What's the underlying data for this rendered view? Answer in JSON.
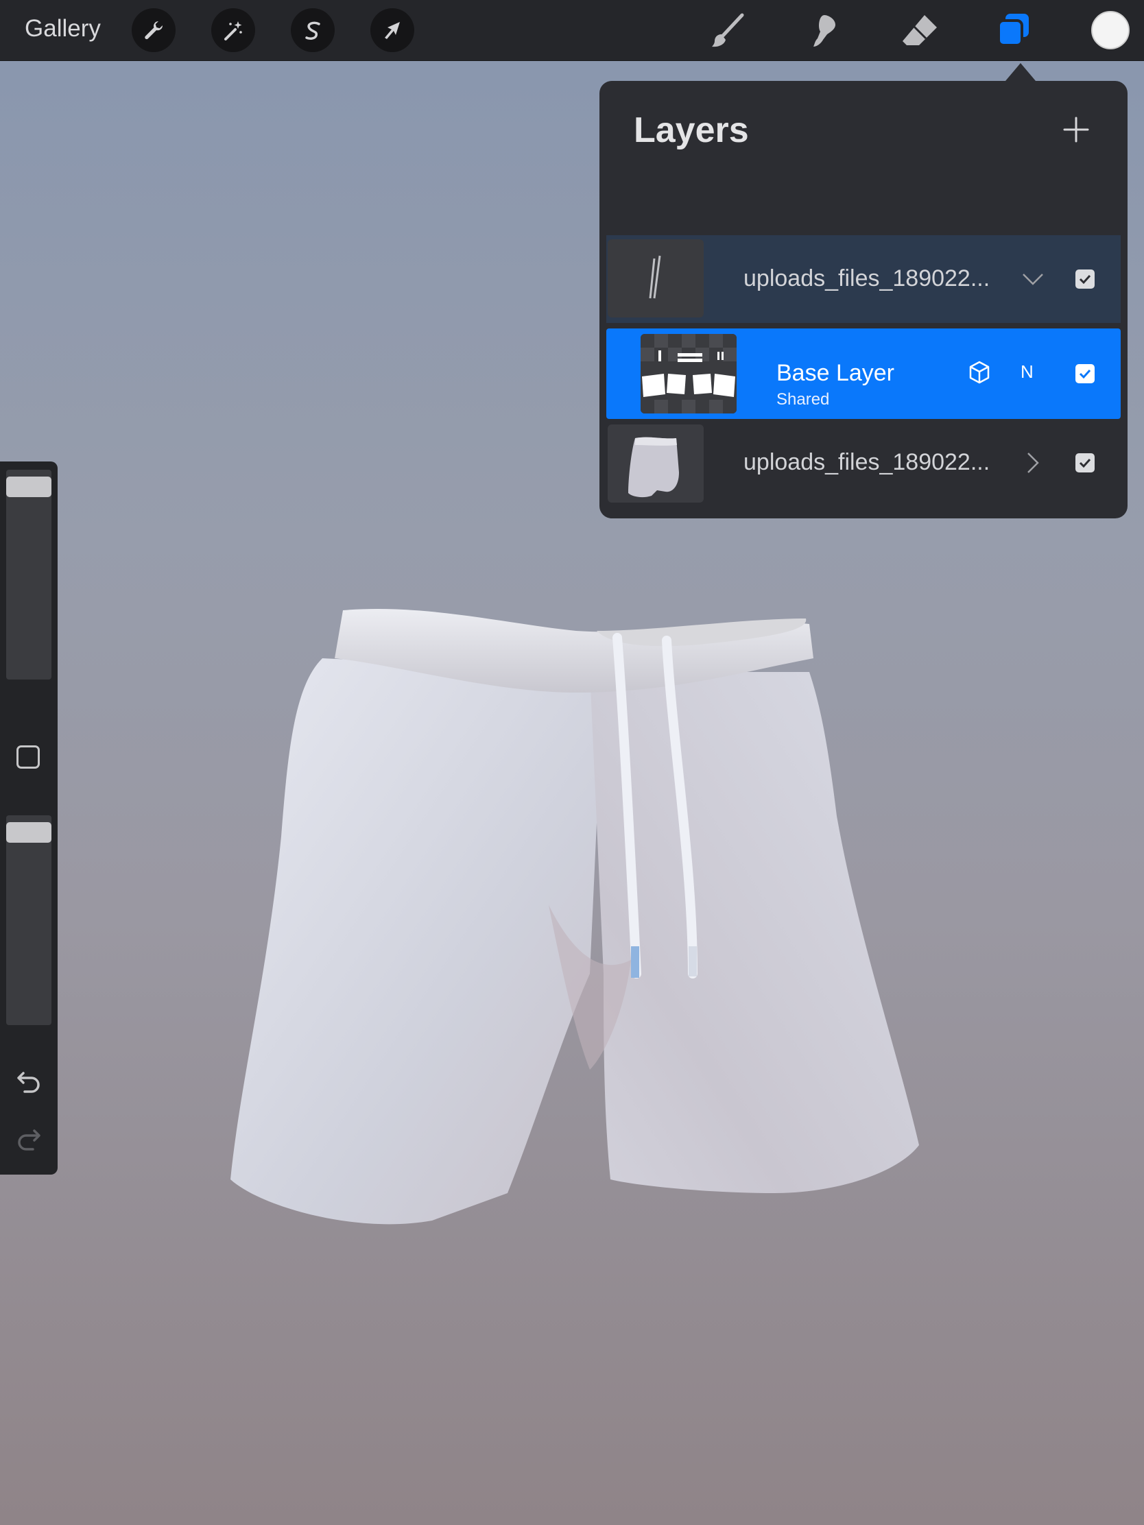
{
  "toolbar": {
    "gallery_label": "Gallery",
    "left_tools": [
      "wrench-icon",
      "magic-wand-icon",
      "selection-icon",
      "transform-arrow-icon"
    ],
    "right_tools": [
      "brush-icon",
      "smudge-icon",
      "eraser-icon",
      "layers-icon"
    ],
    "active_tool": "layers-icon",
    "accent": "#0a78fb",
    "current_color": "#f4f4f4"
  },
  "sidebar": {
    "brush_size_level": 0.0,
    "opacity_level": 0.0,
    "icons": [
      "modify-square-icon",
      "undo-icon",
      "redo-icon"
    ]
  },
  "layers": {
    "title": "Layers",
    "add_icon": "plus-icon",
    "rows": [
      {
        "name": "uploads_files_189022...",
        "expander": "chevron-down-icon",
        "visible": true
      },
      {
        "name": "Base Layer",
        "subtitle": "Shared",
        "blend_mode": "N",
        "selected": true,
        "visible": true
      },
      {
        "name": "uploads_files_189022...",
        "expander": "chevron-right-icon",
        "visible": true
      }
    ]
  }
}
